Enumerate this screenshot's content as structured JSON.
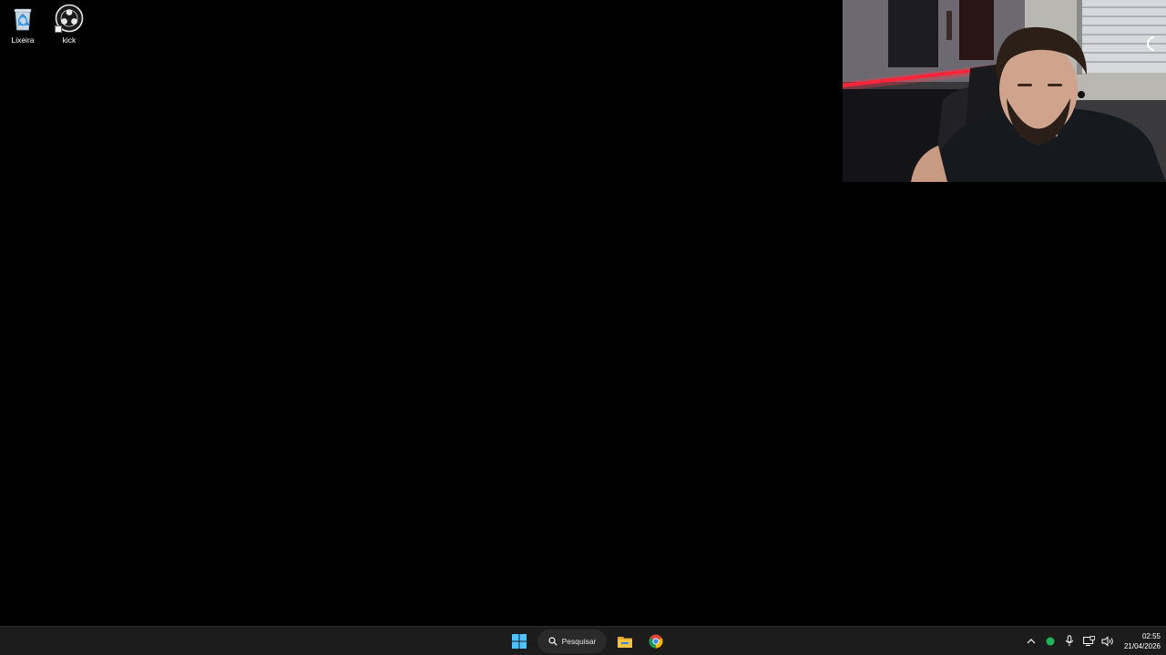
{
  "desktop": {
    "icons": [
      {
        "label": "Lixeira",
        "icon": "recycle-bin-icon"
      },
      {
        "label": "kick",
        "icon": "obs-studio-icon"
      }
    ]
  },
  "webcam": {
    "content": "webcam-overlay"
  },
  "taskbar": {
    "start_icon": "windows-start-icon",
    "search_label": "Pesquisar",
    "search_icon": "search-icon",
    "apps": [
      {
        "icon": "file-explorer-icon"
      },
      {
        "icon": "chrome-icon"
      }
    ],
    "tray": {
      "icons": [
        "chevron-up-icon",
        "status-dot-icon",
        "microphone-icon",
        "display-icon",
        "speaker-icon"
      ],
      "status_color": "#21b25a"
    },
    "clock": {
      "time": "02:55",
      "date": "21/04/2026"
    }
  },
  "colors": {
    "taskbar_bg": "#1c1c1c",
    "accent_blue": "#4cc2ff",
    "folder_yellow": "#f6c343"
  }
}
